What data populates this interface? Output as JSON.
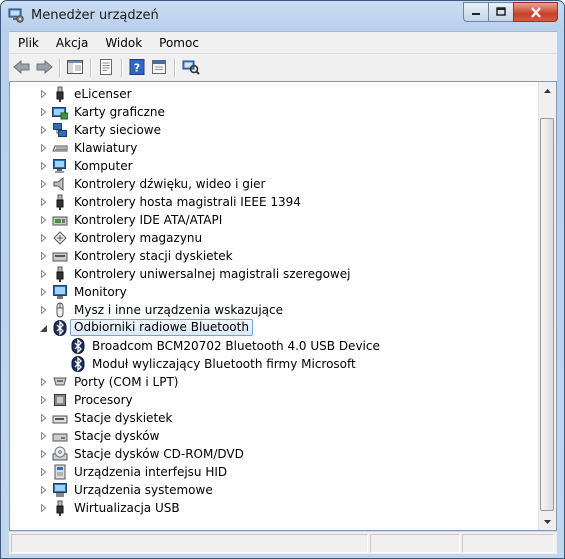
{
  "window": {
    "title": "Menedżer urządzeń"
  },
  "menu": {
    "items": [
      "Plik",
      "Akcja",
      "Widok",
      "Pomoc"
    ]
  },
  "toolbar": {
    "icons": [
      "back-icon",
      "forward-icon",
      "show-hide-console-tree-icon",
      "properties-icon",
      "help-icon",
      "scan-hardware-icon"
    ]
  },
  "tree": {
    "items": [
      {
        "label": "eLicenser",
        "level": 0,
        "expanded": false,
        "icon": "usb-icon"
      },
      {
        "label": "Karty graficzne",
        "level": 0,
        "expanded": false,
        "icon": "display-adapter-icon"
      },
      {
        "label": "Karty sieciowe",
        "level": 0,
        "expanded": false,
        "icon": "network-adapter-icon"
      },
      {
        "label": "Klawiatury",
        "level": 0,
        "expanded": false,
        "icon": "keyboard-icon"
      },
      {
        "label": "Komputer",
        "level": 0,
        "expanded": false,
        "icon": "computer-icon"
      },
      {
        "label": "Kontrolery dźwięku, wideo i gier",
        "level": 0,
        "expanded": false,
        "icon": "speaker-icon"
      },
      {
        "label": "Kontrolery hosta magistrali IEEE 1394",
        "level": 0,
        "expanded": false,
        "icon": "usb-icon"
      },
      {
        "label": "Kontrolery IDE ATA/ATAPI",
        "level": 0,
        "expanded": false,
        "icon": "ide-controller-icon"
      },
      {
        "label": "Kontrolery magazynu",
        "level": 0,
        "expanded": false,
        "icon": "storage-controller-icon"
      },
      {
        "label": "Kontrolery stacji dyskietek",
        "level": 0,
        "expanded": false,
        "icon": "floppy-controller-icon"
      },
      {
        "label": "Kontrolery uniwersalnej magistrali szeregowej",
        "level": 0,
        "expanded": false,
        "icon": "usb-icon"
      },
      {
        "label": "Monitory",
        "level": 0,
        "expanded": false,
        "icon": "monitor-icon"
      },
      {
        "label": "Mysz i inne urządzenia wskazujące",
        "level": 0,
        "expanded": false,
        "icon": "mouse-icon"
      },
      {
        "label": "Odbiorniki radiowe Bluetooth",
        "level": 0,
        "expanded": true,
        "selected": true,
        "icon": "bluetooth-icon"
      },
      {
        "label": "Broadcom BCM20702 Bluetooth 4.0 USB Device",
        "level": 1,
        "icon": "bluetooth-icon"
      },
      {
        "label": "Moduł wyliczający Bluetooth firmy Microsoft",
        "level": 1,
        "icon": "bluetooth-icon"
      },
      {
        "label": "Porty (COM i LPT)",
        "level": 0,
        "expanded": false,
        "icon": "port-icon"
      },
      {
        "label": "Procesory",
        "level": 0,
        "expanded": false,
        "icon": "processor-icon"
      },
      {
        "label": "Stacje dyskietek",
        "level": 0,
        "expanded": false,
        "icon": "floppy-drive-icon"
      },
      {
        "label": "Stacje dysków",
        "level": 0,
        "expanded": false,
        "icon": "disk-drive-icon"
      },
      {
        "label": "Stacje dysków CD-ROM/DVD",
        "level": 0,
        "expanded": false,
        "icon": "cdrom-icon"
      },
      {
        "label": "Urządzenia interfejsu HID",
        "level": 0,
        "expanded": false,
        "icon": "hid-icon"
      },
      {
        "label": "Urządzenia systemowe",
        "level": 0,
        "expanded": false,
        "icon": "system-device-icon"
      },
      {
        "label": "Wirtualizacja USB",
        "level": 0,
        "expanded": false,
        "icon": "usb-icon"
      }
    ]
  }
}
